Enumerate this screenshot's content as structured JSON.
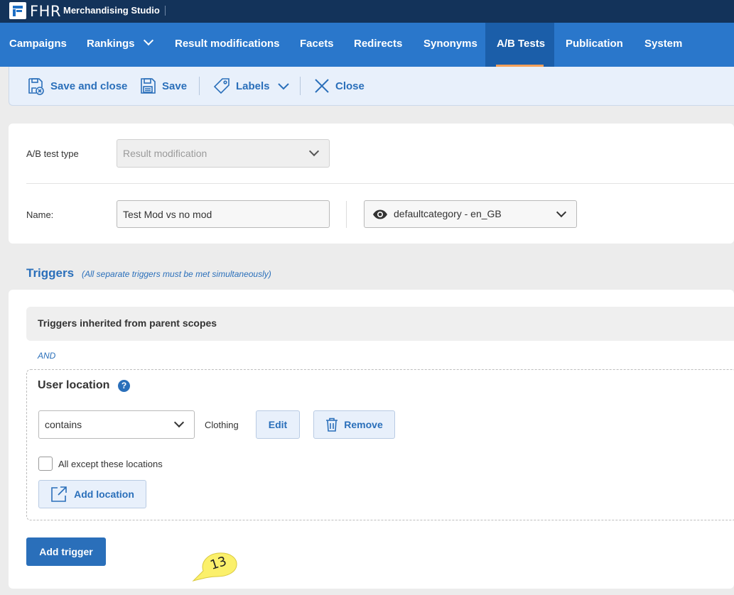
{
  "brand": {
    "logo_text": "FHR",
    "product_name": "Merchandising Studio"
  },
  "nav": {
    "items": [
      {
        "label": "Campaigns"
      },
      {
        "label": "Rankings"
      },
      {
        "label": "Result modifications"
      },
      {
        "label": "Facets"
      },
      {
        "label": "Redirects"
      },
      {
        "label": "Synonyms"
      },
      {
        "label": "A/B Tests"
      },
      {
        "label": "Publication"
      },
      {
        "label": "System"
      }
    ],
    "active": "A/B Tests"
  },
  "toolbar": {
    "save_close_label": "Save and close",
    "save_label": "Save",
    "labels_label": "Labels",
    "close_label": "Close"
  },
  "form": {
    "test_type_label": "A/B test type",
    "test_type_value": "Result modification",
    "name_label": "Name:",
    "name_value": "Test Mod vs no mod",
    "scope_value": "defaultcategory - en_GB"
  },
  "triggers": {
    "title": "Triggers",
    "note": "(All separate triggers must be met simultaneously)",
    "inherited_label": "Triggers inherited from parent scopes",
    "and_label": "AND",
    "trigger": {
      "title": "User location",
      "help": "?",
      "condition": "contains",
      "value": "Clothing",
      "edit_label": "Edit",
      "remove_label": "Remove",
      "except_label": "All except these locations",
      "except_checked": false,
      "add_location_label": "Add location"
    },
    "add_trigger_label": "Add trigger"
  },
  "annotation": {
    "number": "13"
  },
  "colors": {
    "brand_dark": "#13335a",
    "nav_blue": "#2a77cb",
    "accent_orange": "#f5a05a",
    "link_blue": "#2a6fba"
  }
}
